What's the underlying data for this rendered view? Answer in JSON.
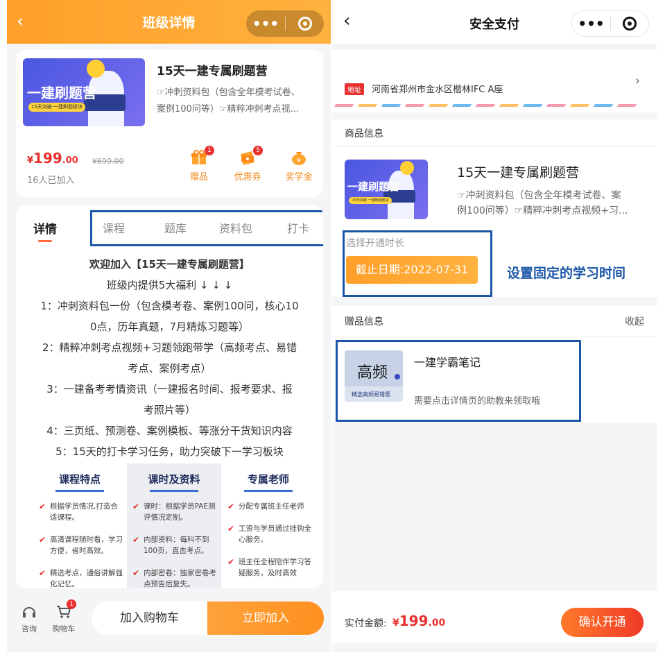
{
  "left": {
    "header": {
      "title": "班级详情",
      "back_icon": "chevron-left-icon",
      "more_icon": "more-dots-icon",
      "close_icon": "target-circle-icon"
    },
    "product": {
      "banner_text": "一建刷题营",
      "banner_subtext": "15天突破·一建刷题板块",
      "title": "15天一建专属刷题营",
      "desc_line1": "☞冲刺资料包（包含全年模考试卷、",
      "desc_line2": "案例100问等）☞精粹冲刺考点视...",
      "price_symbol": "¥",
      "price_int": "199",
      "price_dec": ".00",
      "old_price": "¥699.00",
      "joined": "16人已加入",
      "perks": [
        {
          "label": "赠品",
          "badge": "1",
          "icon": "gift-icon"
        },
        {
          "label": "优惠券",
          "badge": "5",
          "icon": "coupon-icon"
        },
        {
          "label": "奖学金",
          "badge": "",
          "icon": "money-bag-icon"
        }
      ]
    },
    "tabs": [
      "详情",
      "课程",
      "题库",
      "资料包",
      "打卡"
    ],
    "detail_lines": [
      "欢迎加入【15天一建专属刷题营】",
      "班级内提供5大福利 ↓ ↓ ↓",
      "1：冲刺资料包一份（包含模考卷、案例100问，核心10",
      "0点，历年真题，7月精炼习题等）",
      "2：精粹冲刺考点视频+习题领跑带学（高频考点、易错",
      "考点、案例考点）",
      "3：一建备考考情资讯（一建报名时间、报考要求、报",
      "考照片等）",
      "4：三页纸、预测卷、案例模板、等涨分干货知识内容",
      "5：15天的打卡学习任务，助力突破下一学习板块"
    ],
    "features": [
      {
        "title": "课程特点",
        "items": [
          "根据学员情况,打造合适课程。",
          "高清课程随时看，学习方便，省时高效。",
          "精选考点，通俗讲解强化记忆。"
        ]
      },
      {
        "title": "课时及资料",
        "items": [
          "课时：根据学员PAE测评情况定制。",
          "内部资料：每科不到100页，直击考点。",
          "内部密卷：独家密卷考点预告后复失。"
        ]
      },
      {
        "title": "专属老师",
        "items": [
          "分配专属班主任老师",
          "工资与学员通过挂钩全心服务。",
          "班主任全程陪伴学习答疑服务，及时高效"
        ]
      }
    ],
    "bottom": {
      "consult_label": "咨询",
      "cart_label": "购物车",
      "cart_badge": "1",
      "add_cart": "加入购物车",
      "join_now": "立即加入"
    }
  },
  "right": {
    "header": {
      "title": "安全支付",
      "back_icon": "chevron-left-icon",
      "more_icon": "more-dots-icon",
      "close_icon": "target-circle-icon"
    },
    "address": {
      "tag": "地址",
      "text": "河南省郑州市金水区楷林IFC A座"
    },
    "goods": {
      "heading": "商品信息",
      "title": "15天一建专属刷题营",
      "desc_line1": "☞冲刺资料包（包含全年模考试卷、案",
      "desc_line2": "例100问等）☞精粹冲刺考点视频+习...",
      "period_label": "选择开通时长",
      "deadline": "截止日期:2022-07-31",
      "annotation": "设置固定的学习时间"
    },
    "gift": {
      "heading": "赠品信息",
      "collapse": "收起",
      "image_text": "高频",
      "image_subtext": "精选高频易错题",
      "title": "一建学霸笔记",
      "desc": "需要点击详情页的助教来领取哦"
    },
    "bottom": {
      "pay_label": "实付金额:",
      "price_symbol": "¥",
      "price_int": "199",
      "price_dec": ".00",
      "confirm": "确认开通"
    }
  },
  "colors": {
    "accent_orange": "#ff9f2a",
    "price_red": "#e8312f",
    "annotation_blue": "#1b56a8"
  }
}
